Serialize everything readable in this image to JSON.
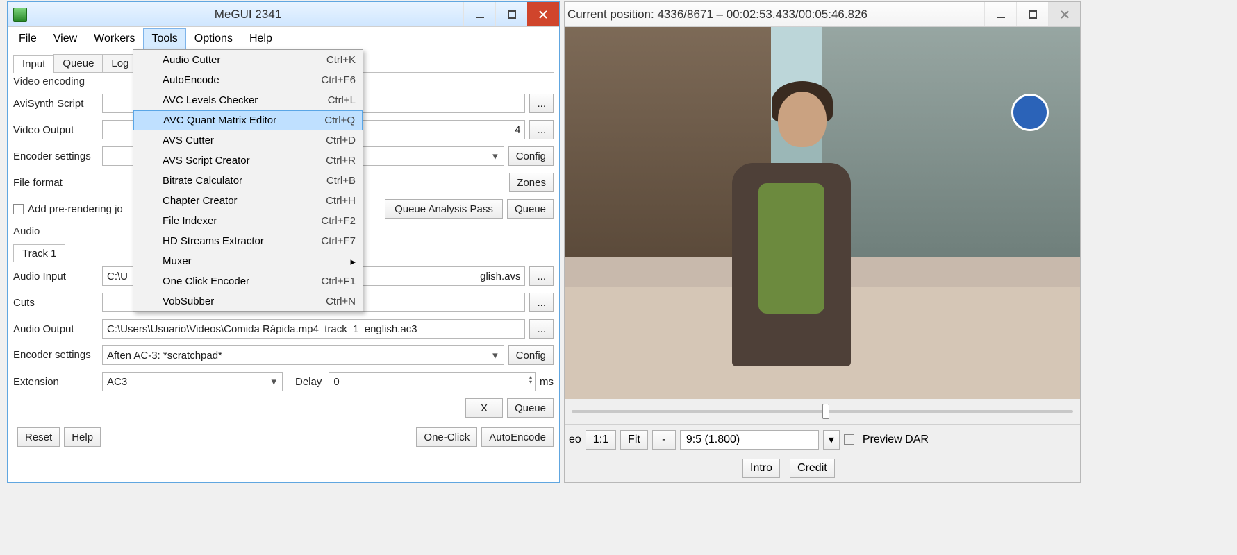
{
  "megui": {
    "title": "MeGUI 2341",
    "menubar": [
      "File",
      "View",
      "Workers",
      "Tools",
      "Options",
      "Help"
    ],
    "active_menu_index": 3,
    "tools_menu": [
      {
        "label": "Audio Cutter",
        "shortcut": "Ctrl+K"
      },
      {
        "label": "AutoEncode",
        "shortcut": "Ctrl+F6"
      },
      {
        "label": "AVC Levels Checker",
        "shortcut": "Ctrl+L"
      },
      {
        "label": "AVC Quant Matrix Editor",
        "shortcut": "Ctrl+Q",
        "highlight": true
      },
      {
        "label": "AVS Cutter",
        "shortcut": "Ctrl+D"
      },
      {
        "label": "AVS Script Creator",
        "shortcut": "Ctrl+R"
      },
      {
        "label": "Bitrate Calculator",
        "shortcut": "Ctrl+B"
      },
      {
        "label": "Chapter Creator",
        "shortcut": "Ctrl+H"
      },
      {
        "label": "File Indexer",
        "shortcut": "Ctrl+F2"
      },
      {
        "label": "HD Streams Extractor",
        "shortcut": "Ctrl+F7"
      },
      {
        "label": "Muxer",
        "shortcut": "",
        "submenu": true
      },
      {
        "label": "One Click Encoder",
        "shortcut": "Ctrl+F1"
      },
      {
        "label": "VobSubber",
        "shortcut": "Ctrl+N"
      }
    ],
    "tabs": [
      "Input",
      "Queue",
      "Log"
    ],
    "video": {
      "section": "Video encoding",
      "avisynth_label": "AviSynth Script",
      "output_label": "Video Output",
      "output_value_suffix": "4",
      "encoder_label": "Encoder settings",
      "config_btn": "Config",
      "format_label": "File format",
      "zones_btn": "Zones",
      "prerender_label": "Add pre-rendering jo",
      "analysis_btn": "Queue Analysis Pass",
      "queue_btn": "Queue"
    },
    "audio": {
      "section": "Audio",
      "track_tab": "Track 1",
      "input_label": "Audio Input",
      "input_prefix": "C:\\U",
      "input_suffix": "glish.avs",
      "cuts_label": "Cuts",
      "output_label": "Audio Output",
      "output_value": "C:\\Users\\Usuario\\Videos\\Comida Rápida.mp4_track_1_english.ac3",
      "encoder_label": "Encoder settings",
      "encoder_value": "Aften AC-3: *scratchpad*",
      "config_btn": "Config",
      "ext_label": "Extension",
      "ext_value": "AC3",
      "delay_label": "Delay",
      "delay_value": "0",
      "delay_unit": "ms",
      "x_btn": "X",
      "queue_btn": "Queue"
    },
    "footer": {
      "reset": "Reset",
      "help": "Help",
      "oneclick": "One-Click",
      "autoencode": "AutoEncode"
    }
  },
  "preview": {
    "title": "Current position: 4336/8671   –   00:02:53.433/00:05:46.826",
    "position_frame": 4336,
    "total_frames": 8671,
    "position_time": "00:02:53.433",
    "total_time": "00:05:46.826",
    "slider_ratio": 0.5,
    "ratio_btns": {
      "one_one": "1:1",
      "fit": "Fit",
      "minus": "-"
    },
    "aspect_value": "9:5 (1.800)",
    "preview_dar": "Preview DAR",
    "eo_suffix": "eo",
    "intro_btn": "Intro",
    "credit_btn": "Credit"
  }
}
